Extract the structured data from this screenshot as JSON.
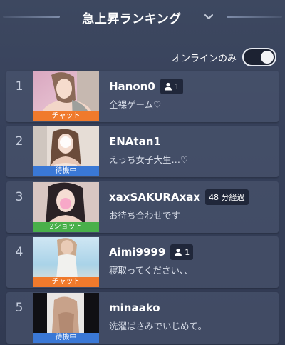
{
  "header": {
    "title": "急上昇ランキング",
    "dropdown_icon": "chevron-down-icon"
  },
  "filter": {
    "online_only_label": "オンラインのみ",
    "online_only_enabled": true
  },
  "ranking": [
    {
      "rank": "1",
      "name": "Hanon0",
      "badge": "1",
      "badge_icon": "person-icon",
      "message": "全裸ゲーム♡",
      "status": "チャット",
      "status_color": "#f07a2c"
    },
    {
      "rank": "2",
      "name": "ENAtan1",
      "badge": "",
      "badge_icon": "",
      "message": "えっち女子大生…♡",
      "status": "待機中",
      "status_color": "#3a78d6"
    },
    {
      "rank": "3",
      "name": "xaxSAKURAxax",
      "badge": "48 分経過",
      "badge_icon": "",
      "message": "お待ち合わせです",
      "status": "2ショット",
      "status_color": "#49b04a"
    },
    {
      "rank": "4",
      "name": "Aimi9999",
      "badge": "1",
      "badge_icon": "person-icon",
      "message": "寝取ってください、、",
      "status": "チャット",
      "status_color": "#f07a2c"
    },
    {
      "rank": "5",
      "name": "minaako",
      "badge": "",
      "badge_icon": "",
      "message": "洗濯ばさみでいじめて。",
      "status": "待機中",
      "status_color": "#3a78d6"
    }
  ]
}
